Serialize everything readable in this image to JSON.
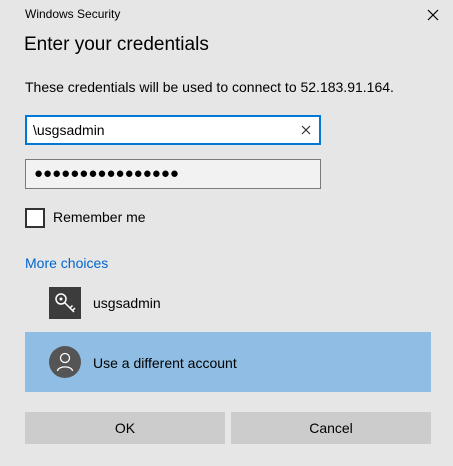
{
  "window": {
    "title": "Windows Security"
  },
  "dialog": {
    "heading": "Enter your credentials",
    "info": "These credentials will be used to connect to 52.183.91.164."
  },
  "username": {
    "value": "\\usgsadmin"
  },
  "password": {
    "masked_value": "●●●●●●●●●●●●●●●●"
  },
  "remember": {
    "label": "Remember me",
    "checked": false
  },
  "more_choices": {
    "label": "More choices"
  },
  "accounts": [
    {
      "label": "usgsadmin",
      "icon": "key-icon",
      "selected": false
    },
    {
      "label": "Use a different account",
      "icon": "user-icon",
      "selected": true
    }
  ],
  "buttons": {
    "ok": "OK",
    "cancel": "Cancel"
  },
  "colors": {
    "background": "#e6e6e6",
    "accent": "#0078d7",
    "link": "#0066cc",
    "selected_item": "#8fbde3",
    "button": "#cccccc"
  }
}
